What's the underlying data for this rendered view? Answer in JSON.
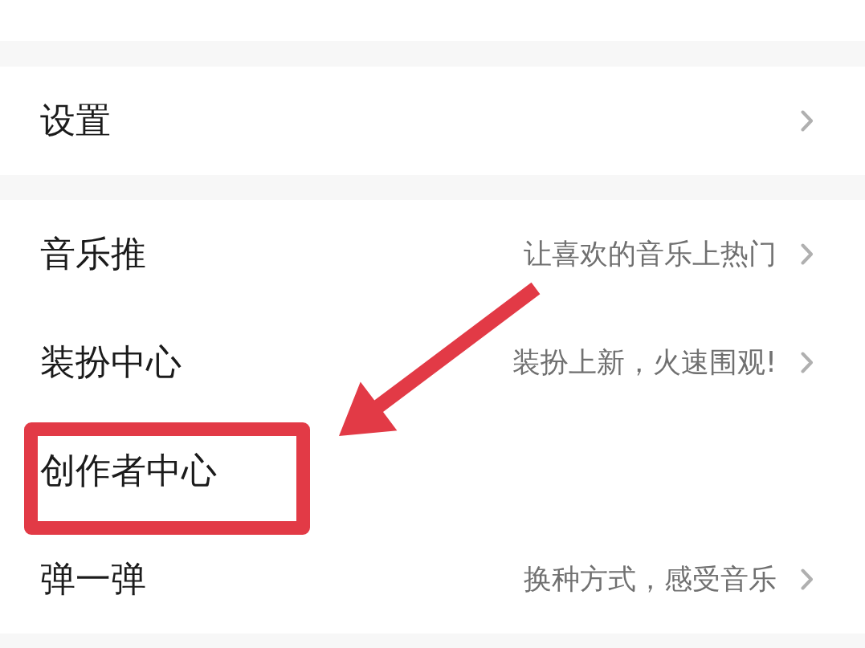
{
  "sections": [
    {
      "rows": [
        {
          "title": "设置",
          "chevron": true,
          "highlighted": false
        }
      ]
    },
    {
      "rows": [
        {
          "title": "音乐推",
          "subtitle": "让喜欢的音乐上热门",
          "chevron": true,
          "highlighted": false
        },
        {
          "title": "装扮中心",
          "subtitle": "装扮上新，火速围观!",
          "chevron": true,
          "highlighted": false
        },
        {
          "title": "创作者中心",
          "chevron": false,
          "highlighted": true
        },
        {
          "title": "弹一弹",
          "subtitle": "换种方式，感受音乐",
          "chevron": true,
          "highlighted": false
        }
      ]
    }
  ]
}
